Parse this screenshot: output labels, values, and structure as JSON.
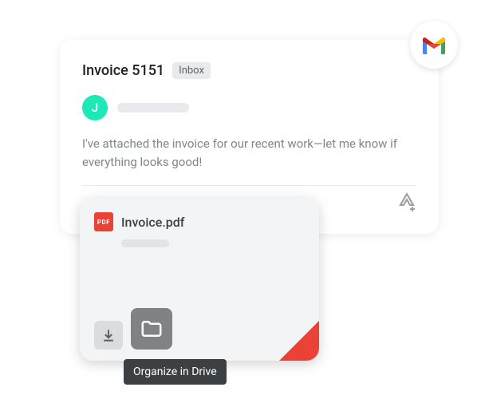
{
  "email": {
    "subject": "Invoice 5151",
    "inbox_label": "Inbox",
    "avatar_initial": "J",
    "body": "I've attached the invoice for our recent work—let me know if everything looks good!"
  },
  "attachment": {
    "file_type_label": "PDF",
    "file_name": "Invoice.pdf"
  },
  "tooltip": {
    "text": "Organize in Drive"
  }
}
